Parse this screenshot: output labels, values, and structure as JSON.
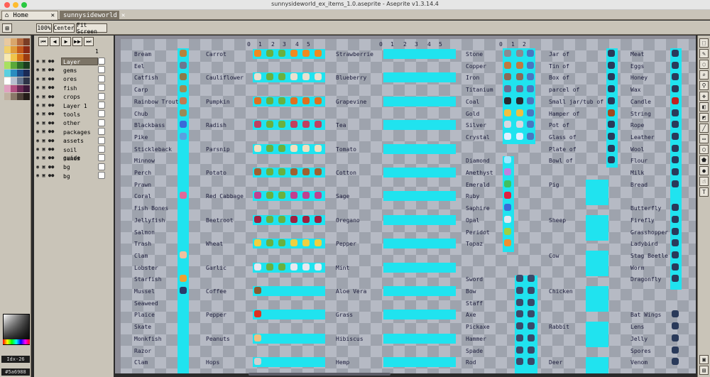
{
  "window": {
    "title": "sunnysideworld_ex_items_1.0.aseprite - Aseprite v1.3.14.4"
  },
  "tabs": [
    {
      "label": "Home"
    },
    {
      "label": "sunnysideworld"
    }
  ],
  "toolbar": {
    "zoom_label": "100%",
    "center_label": "Center",
    "fit_label": "Fit Screen"
  },
  "palette": {
    "colors": [
      "#e8c9a0",
      "#d9a66b",
      "#b56b3f",
      "#7a3d25",
      "#f2d06b",
      "#e09b3a",
      "#c45a1c",
      "#8a2a14",
      "#f7e9b0",
      "#f0c44a",
      "#d8781a",
      "#9a3a10",
      "#a8e060",
      "#5aa83a",
      "#2e6d2a",
      "#1b3d20",
      "#5ad0e0",
      "#2a8cc0",
      "#1e4d8a",
      "#1b2a55",
      "#ffffff",
      "#b8c0d0",
      "#6a7890",
      "#2e3448",
      "#e0a0c0",
      "#b05080",
      "#6a2a55",
      "#3a1838",
      "#c0b0a0",
      "#8a7868",
      "#4e4038",
      "#241c18"
    ],
    "index_label": "Idx-26",
    "hex_label": "#5a6988"
  },
  "layers": [
    {
      "name": "Layer",
      "selected": true
    },
    {
      "name": "gems",
      "selected": false
    },
    {
      "name": "ores",
      "selected": false
    },
    {
      "name": "fish",
      "selected": false
    },
    {
      "name": "crops",
      "selected": false
    },
    {
      "name": "Layer 1",
      "selected": false
    },
    {
      "name": "tools",
      "selected": false
    },
    {
      "name": "other",
      "selected": false
    },
    {
      "name": "packages",
      "selected": false
    },
    {
      "name": "assets",
      "selected": false
    },
    {
      "name": "soil guide",
      "selected": false
    },
    {
      "name": "names",
      "selected": false
    },
    {
      "name": "bg",
      "selected": false
    },
    {
      "name": "bg",
      "selected": false
    }
  ],
  "frame_number": "1",
  "headers": {
    "crop_stages": [
      "0",
      "1",
      "2",
      "3",
      "4",
      "5"
    ],
    "berry_stages": [
      "0",
      "1",
      "2",
      "3",
      "4",
      "5"
    ],
    "ore_stages": [
      "0",
      "1",
      "2"
    ]
  },
  "columns": {
    "fish": [
      "Bream",
      "Eel",
      "Catfish",
      "Carp",
      "Rainbow Trout",
      "Chub",
      "Blackbass",
      "Pike",
      "Stickleback",
      "Minnow",
      "Perch",
      "Prawn",
      "Coral",
      "Fish Bones",
      "Jellyfish",
      "Salmon",
      "Trash",
      "Clam",
      "Lobster",
      "Starfish",
      "Mussel",
      "Seaweed",
      "Plaice",
      "Skate",
      "Monkfish",
      "Razor",
      "Clam"
    ],
    "crops": [
      "Carrot",
      "",
      "Cauliflower",
      "",
      "Pumpkin",
      "",
      "Radish",
      "",
      "Parsnip",
      "",
      "Potato",
      "",
      "Red Cabbage",
      "",
      "Beetroot",
      "",
      "Wheat",
      "",
      "Garlic",
      "",
      "Coffee",
      "",
      "Pepper",
      "",
      "Peanuts",
      "",
      "Hops"
    ],
    "berries": [
      "Strawberrie",
      "",
      "Blueberry",
      "",
      "Grapevine",
      "",
      "Tea",
      "",
      "Tomato",
      "",
      "Cotton",
      "",
      "Sage",
      "",
      "Oregano",
      "",
      "Pepper",
      "",
      "Mint",
      "",
      "Aloe Vera",
      "",
      "Grass",
      "",
      "Hibiscus",
      "",
      "Hemp"
    ],
    "ores": [
      "Stone",
      "Copper",
      "Iron",
      "Titanium",
      "Coal",
      "Gold",
      "Silver",
      "Crystal",
      "",
      "Diamond",
      "Amethyst",
      "Emerald",
      "Ruby",
      "Saphire",
      "Opal",
      "Peridot",
      "Topaz",
      "",
      "",
      "Sword",
      "Bow",
      "Staff",
      "Axe",
      "Pickaxe",
      "Hammer",
      "Spade",
      "Rod"
    ],
    "containers": [
      "Jar of",
      "Tin of",
      "Box of",
      "parcel of",
      "Small jar/tub of",
      "Hamper of",
      "Pot of",
      "Glass of",
      "Plate of",
      "Bowl of",
      "",
      "Pig",
      "",
      "",
      "Sheep",
      "",
      "",
      "Cow",
      "",
      "",
      "Chicken",
      "",
      "",
      "Rabbit",
      "",
      "",
      "Deer"
    ],
    "goods": [
      "Meat",
      "Eggs",
      "Honey",
      "Wax",
      "Candle",
      "String",
      "Rope",
      "Leather",
      "Wool",
      "Flour",
      "Milk",
      "Bread",
      "",
      "Butterfly",
      "Firefly",
      "Grasshopper",
      "Ladybird",
      "Stag Beetle",
      "Worm",
      "Dragonfly",
      "",
      "",
      "Bat Wings",
      "Lens",
      "Jelly",
      "Spores",
      "Venom"
    ]
  }
}
